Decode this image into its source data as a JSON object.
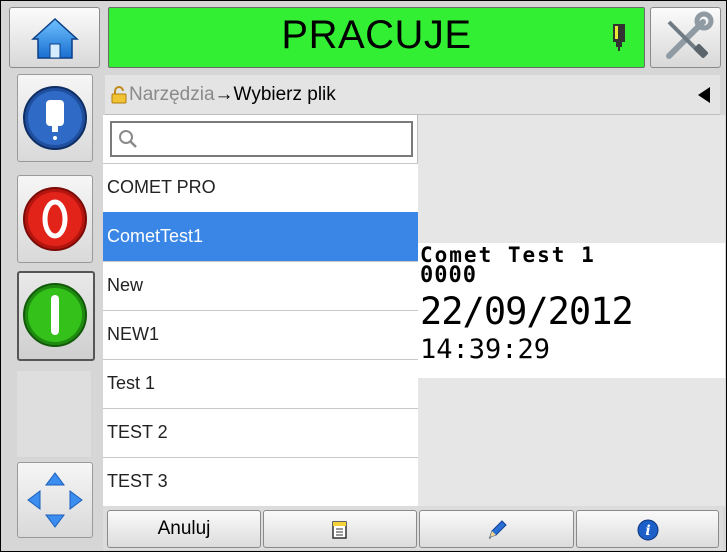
{
  "status": {
    "label": "PRACUJE",
    "color": "#33ef33"
  },
  "header": {
    "home_icon": "home-icon",
    "ink_icon": "ink-cartridge-icon",
    "tools_icon": "tools-icon"
  },
  "breadcrumb": {
    "lock_icon": "lock-icon",
    "parent": "Narzędzia",
    "arrow": "→",
    "current": "Wybierz plik",
    "back_icon": "back-arrow-icon"
  },
  "search": {
    "placeholder": "",
    "icon": "search-icon"
  },
  "files": [
    {
      "name": "COMET PRO",
      "selected": false
    },
    {
      "name": "CometTest1",
      "selected": true
    },
    {
      "name": "New",
      "selected": false
    },
    {
      "name": "NEW1",
      "selected": false
    },
    {
      "name": "Test 1",
      "selected": false
    },
    {
      "name": "TEST 2",
      "selected": false
    },
    {
      "name": "TEST 3",
      "selected": false
    }
  ],
  "preview": {
    "line1": "Comet Test 1",
    "line2": "0000",
    "line3": "22/09/2012",
    "line4": "14:39:29"
  },
  "bottom": {
    "cancel_label": "Anuluj",
    "new_icon": "new-document-icon",
    "edit_icon": "pencil-icon",
    "info_icon": "info-icon"
  },
  "left_buttons": [
    "ink-system-icon",
    "stop-icon",
    "start-icon",
    "navigation-arrows-icon"
  ],
  "colors": {
    "selection": "#3a86e6",
    "stop": "#e2231a",
    "start": "#33c11a"
  }
}
